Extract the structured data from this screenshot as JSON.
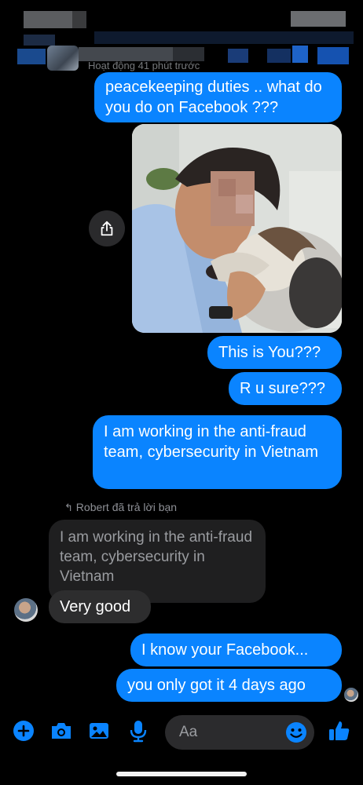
{
  "header": {
    "subtitle": "Hoạt động 41 phút trước"
  },
  "messages": [
    {
      "id": "m1",
      "text": "peacekeeping duties .. what do you do on Facebook ???"
    },
    {
      "id": "m2",
      "text": "This is You???"
    },
    {
      "id": "m3",
      "text": "R u sure???"
    },
    {
      "id": "m4",
      "text": "I am working in the anti-fraud team, cybersecurity in Vietnam"
    },
    {
      "id": "m5",
      "reply_label": "Robert đã trả lời bạn",
      "quoted": "I am working in the anti-fraud team, cybersecurity in Vietnam",
      "text": "Very good"
    },
    {
      "id": "m6",
      "text": "I know your Facebook..."
    },
    {
      "id": "m7",
      "text": "you only got it 4 days ago"
    }
  ],
  "composer": {
    "placeholder": "Aa"
  },
  "toolbar": {
    "icons": [
      "plus-icon",
      "camera-icon",
      "image-icon",
      "microphone-icon",
      "emoji-icon",
      "like-icon"
    ]
  },
  "colors": {
    "accent": "#0a84ff",
    "outgoing_bubble": "#0a84ff",
    "incoming_bubble": "#2a2a2b",
    "background": "#000000"
  }
}
